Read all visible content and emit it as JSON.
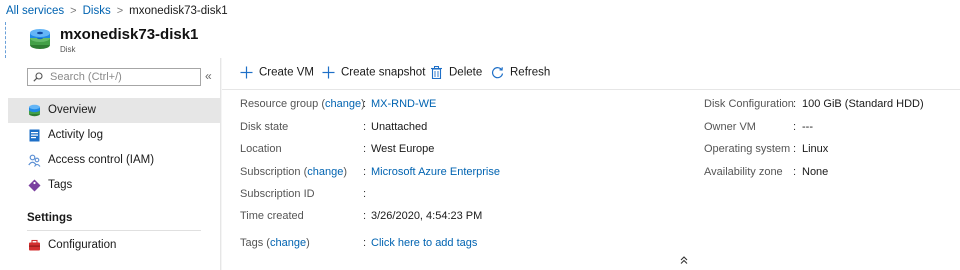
{
  "breadcrumb": {
    "items": [
      "All services",
      "Disks"
    ],
    "current": "mxonedisk73-disk1"
  },
  "header": {
    "title": "mxonedisk73-disk1",
    "subtitle": "Disk"
  },
  "sidebar": {
    "search_placeholder": "Search (Ctrl+/)",
    "collapse_glyph": "«",
    "items": [
      {
        "label": "Overview",
        "icon": "overview-icon"
      },
      {
        "label": "Activity log",
        "icon": "activity-log-icon"
      },
      {
        "label": "Access control (IAM)",
        "icon": "access-control-icon"
      },
      {
        "label": "Tags",
        "icon": "tag-icon"
      }
    ],
    "settings_title": "Settings",
    "settings_items": [
      {
        "label": "Configuration",
        "icon": "configuration-icon"
      }
    ]
  },
  "toolbar": {
    "create_vm": "Create VM",
    "create_snapshot": "Create snapshot",
    "delete": "Delete",
    "refresh": "Refresh"
  },
  "essentials": {
    "left": {
      "resource_group": {
        "label": "Resource group",
        "change": "change",
        "value": "MX-RND-WE"
      },
      "disk_state": {
        "label": "Disk state",
        "value": "Unattached"
      },
      "location": {
        "label": "Location",
        "value": "West Europe"
      },
      "subscription": {
        "label": "Subscription",
        "change": "change",
        "value": "Microsoft Azure Enterprise"
      },
      "subscription_id": {
        "label": "Subscription ID",
        "value": ""
      },
      "time_created": {
        "label": "Time created",
        "value": "3/26/2020, 4:54:23 PM"
      },
      "tags": {
        "label": "Tags",
        "change": "change",
        "value": "Click here to add tags"
      }
    },
    "right": {
      "disk_configuration": {
        "label": "Disk Configuration",
        "value": "100 GiB (Standard HDD)"
      },
      "owner_vm": {
        "label": "Owner VM",
        "value": "---"
      },
      "operating_system": {
        "label": "Operating system",
        "value": "Linux"
      },
      "availability_zone": {
        "label": "Availability zone",
        "value": "None"
      }
    },
    "collapse_glyph": "⌃"
  },
  "colors": {
    "link": "#0063b1",
    "active_nav": "#e6e6e6"
  }
}
